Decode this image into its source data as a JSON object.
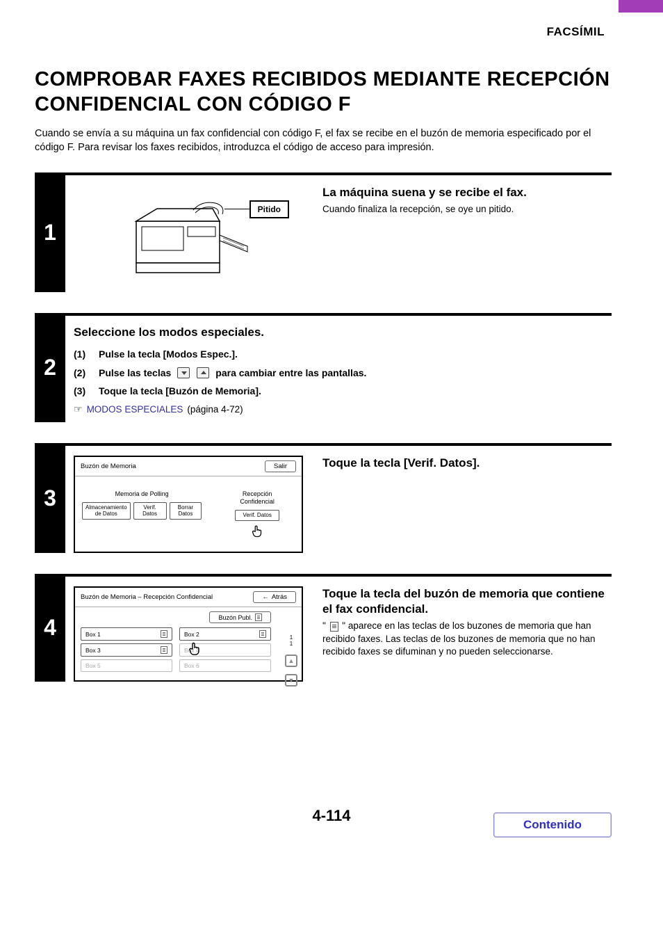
{
  "header": {
    "section": "FACSÍMIL"
  },
  "title": "COMPROBAR FAXES RECIBIDOS MEDIANTE RECEPCIÓN CONFIDENCIAL CON CÓDIGO F",
  "intro": "Cuando se envía a su máquina un fax confidencial con código F, el fax se recibe en el buzón de memoria especificado por el código F. Para revisar los faxes recibidos, introduzca el código de acceso para impresión.",
  "step1": {
    "num": "1",
    "callout": "Pitido",
    "title": "La máquina suena y se recibe el fax.",
    "desc": "Cuando finaliza la recepción, se oye un pitido."
  },
  "step2": {
    "num": "2",
    "title": "Seleccione los modos especiales.",
    "items": {
      "n1": "(1)",
      "t1": "Pulse la tecla [Modos Espec.].",
      "n2": "(2)",
      "t2a": "Pulse las teclas",
      "t2b": "para cambiar entre las pantallas.",
      "n3": "(3)",
      "t3": "Toque la tecla [Buzón de Memoria]."
    },
    "link": {
      "text": "MODOS ESPECIALES",
      "suffix": " (página 4-72)"
    }
  },
  "step3": {
    "num": "3",
    "title": "Toque la tecla [Verif. Datos].",
    "screen": {
      "title": "Buzón de Memoria",
      "exit": "Salir",
      "left_label": "Memoria de Polling",
      "right_label": "Recepción\nConfidencial",
      "btns": {
        "a": "Almacenamiento\nde Datos",
        "b": "Verif. Datos",
        "c": "Borrar Datos",
        "d": "Verif. Datos"
      }
    }
  },
  "step4": {
    "num": "4",
    "title": "Toque la tecla del buzón de memoria que contiene el fax confidencial.",
    "desc_a": "\" ",
    "desc_b": " \" aparece en las teclas de los buzones de memoria que han recibido faxes. Las teclas de los buzones de memoria que no han recibido faxes se difuminan y no pueden seleccionarse.",
    "screen": {
      "title": "Buzón de Memoria – Recepción Confidencial",
      "back": "Atrás",
      "publ": "Buzón Publ.",
      "boxes": {
        "b1": "Box 1",
        "b2": "Box 2",
        "b3": "Box 3",
        "b4": "Box 4",
        "b5": "Box 5",
        "b6": "Box 6"
      },
      "page_top": "1",
      "page_bot": "1"
    }
  },
  "footer": {
    "page": "4-114",
    "toc": "Contenido"
  }
}
